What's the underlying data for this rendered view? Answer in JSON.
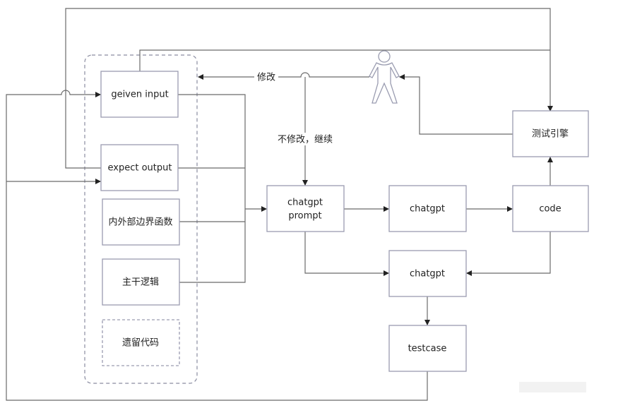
{
  "nodes": {
    "given_input": "geiven input",
    "expect_output": "expect output",
    "boundary_functions": "内外部边界函数",
    "main_logic": "主干逻辑",
    "legacy_code": "遗留代码",
    "prompt_line1": "chatgpt",
    "prompt_line2": "prompt",
    "chatgpt_top": "chatgpt",
    "code": "code",
    "test_engine": "测试引擎",
    "chatgpt_mid": "chatgpt",
    "testcase": "testcase"
  },
  "edge_labels": {
    "modify": "修改",
    "no_modify_continue": "不修改，继续"
  },
  "actor_icon": "person-icon"
}
